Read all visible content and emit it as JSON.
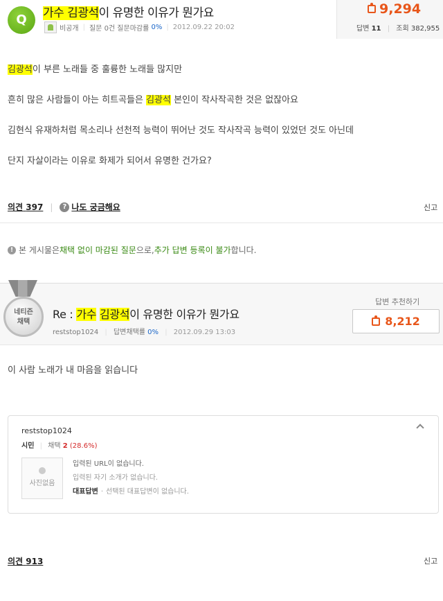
{
  "question": {
    "badge": "Q",
    "title_hl": "가수 김광석",
    "title_rest": "이 유명한 이유가 뭔가요",
    "author": "비공개",
    "stats_text": "질문 0건 질문마감률",
    "close_rate": "0%",
    "date": "2012.09.22 20:02",
    "reco_count": "9,294",
    "answers_label": "답변",
    "answers_count": "11",
    "views_label": "조회",
    "views_count": "382,955",
    "body": {
      "p1_hl": "김광석",
      "p1_rest": "이 부른 노래들 중 훌륭한 노래들 많지만",
      "p2_pre": "흔히 많은 사람들이 아는 히트곡들은 ",
      "p2_hl": "김광석",
      "p2_post": " 본인이 작사작곡한 것은 없잖아요",
      "p3": "김현식 유재하처럼 목소리나 선천적 능력이 뛰어난 것도 작사작곡 능력이 있었던 것도 아닌데",
      "p4": "단지 자살이라는 이유로 화제가 되어서 유명한 건가요?"
    },
    "opinion_label": "의견",
    "opinion_count": "397",
    "me_too": "나도 궁금해요",
    "report": "신고"
  },
  "notice": {
    "pre": "본 게시물은 ",
    "g1": "채택 없이 마감된 질문",
    "mid": "으로, ",
    "g2": "추가 답변 등록이 불가",
    "post": "합니다."
  },
  "answer": {
    "medal_line1": "네티즌",
    "medal_line2": "채택",
    "title_pre": "Re : ",
    "title_hl1": "가수",
    "title_hl2": "김광석",
    "title_rest": "이 유명한 이유가 뭔가요",
    "author": "reststop1024",
    "rate_label": "답변채택률",
    "rate": "0%",
    "date": "2012.09.29 13:03",
    "reco_label": "답변 추천하기",
    "reco_count": "8,212",
    "body": "이 사람 노래가 내 마음을 읽습니다",
    "profile": {
      "name": "reststop1024",
      "rank": "시민",
      "adopt_label": "채택",
      "adopt_count": "2",
      "adopt_pct": "(28.6%)",
      "no_photo": "사진없음",
      "url_info": "입력된 URL이 없습니다.",
      "intro_info": "입력된 자기 소개가 없습니다.",
      "rep_label": "대표답변",
      "rep_info": "선택된 대표답변이 없습니다."
    },
    "opinion_label": "의견",
    "opinion_count": "913",
    "report": "신고"
  }
}
